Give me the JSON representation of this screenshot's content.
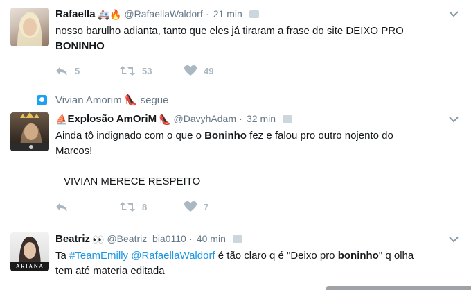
{
  "tweets": [
    {
      "fullname": "Rafaella",
      "emoji": "🚑🔥",
      "username": "@RafaellaWaldorf",
      "separator": "·",
      "time": "21 min",
      "text_line1": "nosso barulho adianta, tanto que eles já tiraram a frase do site DEIXO PRO",
      "text_bold": "BONINHO",
      "reply_count": "5",
      "retweet_count": "53",
      "like_count": "49"
    },
    {
      "context_name": "Vivian Amorim",
      "context_emoji": "👠",
      "context_action": "segue",
      "fullname_prefix_emoji": "⛵",
      "fullname": "Explosão AmOriM",
      "emoji": "👠",
      "username": "@DavyhAdam",
      "separator": "·",
      "time": "32 min",
      "text_a": "Ainda tô indignado com o que o ",
      "text_bold": "Boninho",
      "text_b": " fez e falou pro outro nojento do",
      "text_line2": "Marcos!",
      "text_line3": "VIVIAN MERECE RESPEITO",
      "retweet_count": "8",
      "like_count": "7"
    },
    {
      "fullname": "Beatriz",
      "emoji": "👀",
      "username": "@Beatriz_bia0110",
      "separator": "·",
      "time": "40 min",
      "avatar_text": "ARIANA",
      "text_a": "Ta ",
      "hashtag": "#TeamEmilly",
      "mention": "@RafaellaWaldorf",
      "text_b": " é tão claro q é \"Deixo pro ",
      "text_bold": "boninho",
      "text_c": "\" q olha",
      "text_line2": "tem até materia editada"
    }
  ],
  "colors": {
    "link": "#1b95e0",
    "secondary_text": "#657786",
    "action_icon": "#aab8c2",
    "divider": "#e6ecf0"
  }
}
